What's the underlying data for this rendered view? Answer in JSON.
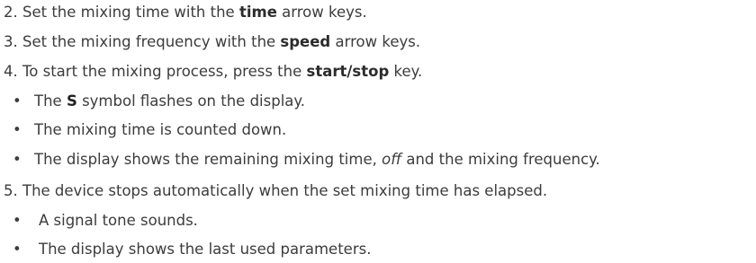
{
  "steps": [
    {
      "number": "2.",
      "before": "Set the mixing time with the ",
      "bold": "time",
      "after": " arrow keys."
    },
    {
      "number": "3.",
      "before": "Set the mixing frequency with the ",
      "bold": "speed",
      "after": " arrow keys."
    },
    {
      "number": "4.",
      "before": "To start the mixing process, press the ",
      "bold": "start/stop",
      "after": " key.",
      "bullets": [
        {
          "marker": "•",
          "before": "The ",
          "symbol": "S",
          "after": " symbol flashes on the display."
        },
        {
          "marker": "•",
          "text": "The mixing time is counted down."
        },
        {
          "marker": "•",
          "before": "The display shows the remaining mixing time, ",
          "italic": "off",
          "after": " and the mixing frequency."
        }
      ]
    },
    {
      "number": "5.",
      "text": "The device stops automatically when the set mixing time has elapsed.",
      "bullets": [
        {
          "marker": "•",
          "text": "A signal tone sounds."
        },
        {
          "marker": "•",
          "text": "The display shows the last used parameters."
        }
      ]
    }
  ]
}
